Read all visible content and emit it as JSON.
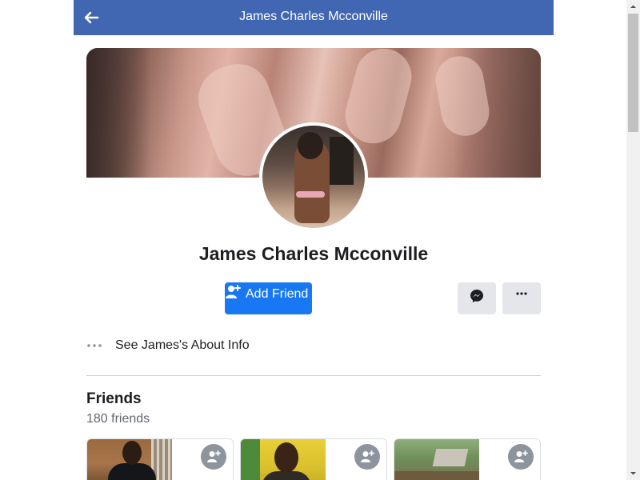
{
  "header": {
    "title": "James Charles Mcconville",
    "back_icon": "arrow-left-icon",
    "bar_color": "#4267b2"
  },
  "profile": {
    "name": "James Charles Mcconville",
    "cover_photo": "cover-photo",
    "avatar": "profile-picture"
  },
  "actions": {
    "add_friend_label": "Add Friend",
    "add_friend_icon": "add-friend-icon",
    "messenger_icon": "messenger-icon",
    "more_icon": "more-options-icon",
    "primary_color": "#1877f2"
  },
  "about": {
    "label": "See James's About Info",
    "icon": "more-dots-icon"
  },
  "friends": {
    "title": "Friends",
    "count": "180 friends",
    "items": [
      {
        "photo": "friend-photo-1",
        "add_icon": "add-friend-icon"
      },
      {
        "photo": "friend-photo-2",
        "add_icon": "add-friend-icon"
      },
      {
        "photo": "friend-photo-3",
        "add_icon": "add-friend-icon"
      }
    ]
  }
}
